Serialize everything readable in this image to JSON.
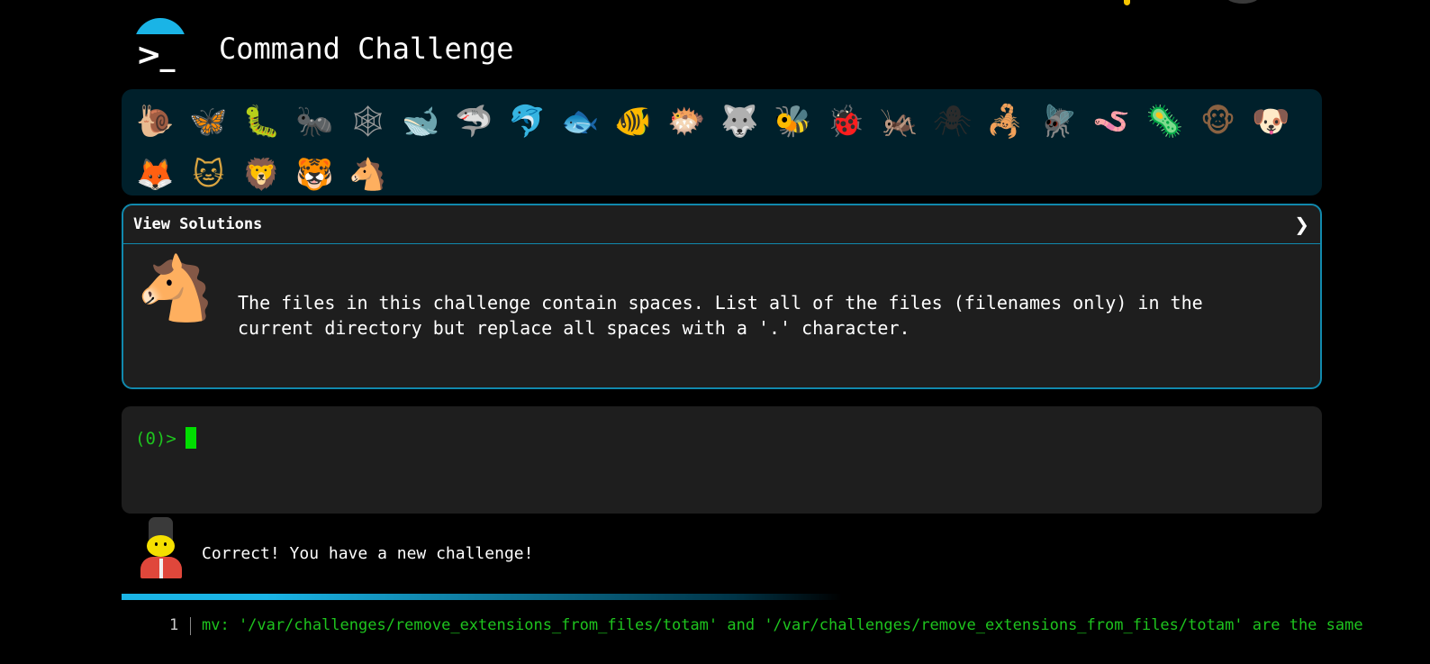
{
  "app": {
    "title": "Command Challenge",
    "logo_icon": "terminal-prompt-icon",
    "accent": "#1ab4e6"
  },
  "animals": [
    {
      "name": "snail",
      "glyph": "🐌",
      "color": "#b07a3c"
    },
    {
      "name": "butterfly",
      "glyph": "🦋",
      "color": "#e08a2c"
    },
    {
      "name": "bug",
      "glyph": "🐛",
      "color": "#7cc242"
    },
    {
      "name": "ant",
      "glyph": "🐜",
      "color": "#3a3a3a"
    },
    {
      "name": "spider-web",
      "glyph": "🕸",
      "color": "#9a9a9a"
    },
    {
      "name": "whale",
      "glyph": "🐋",
      "color": "#3fa3d8"
    },
    {
      "name": "shark",
      "glyph": "🦈",
      "color": "#3fa3d8"
    },
    {
      "name": "dolphin",
      "glyph": "🐬",
      "color": "#9aa6ad"
    },
    {
      "name": "fish",
      "glyph": "🐟",
      "color": "#53b7e8"
    },
    {
      "name": "tropical-fish",
      "glyph": "🐠",
      "color": "#f2c21b"
    },
    {
      "name": "blowfish",
      "glyph": "🐡",
      "color": "#a0713f"
    },
    {
      "name": "wolf",
      "glyph": "🐺",
      "color": "#8d9396"
    },
    {
      "name": "bee",
      "glyph": "🐝",
      "color": "#f5d33a"
    },
    {
      "name": "lady-beetle",
      "glyph": "🐞",
      "color": "#d22f2f"
    },
    {
      "name": "cricket",
      "glyph": "🦗",
      "color": "#6aa84f"
    },
    {
      "name": "spider",
      "glyph": "🕷",
      "color": "#2b2b2b"
    },
    {
      "name": "scorpion",
      "glyph": "🦂",
      "color": "#c0392b"
    },
    {
      "name": "fly",
      "glyph": "🪰",
      "color": "#9aa0a6"
    },
    {
      "name": "worm",
      "glyph": "🪱",
      "color": "#d97fa0"
    },
    {
      "name": "microbe",
      "glyph": "🦠",
      "color": "#3fa3d8"
    },
    {
      "name": "monkey",
      "glyph": "🐵",
      "color": "#8a6242"
    },
    {
      "name": "dog",
      "glyph": "🐶",
      "color": "#d49b4a"
    },
    {
      "name": "fox",
      "glyph": "🦊",
      "color": "#e2632b"
    },
    {
      "name": "cat",
      "glyph": "🐱",
      "color": "#d9a441"
    },
    {
      "name": "lion",
      "glyph": "🦁",
      "color": "#d9a441"
    },
    {
      "name": "tiger",
      "glyph": "🐯",
      "color": "#e8a53a"
    },
    {
      "name": "horse",
      "glyph": "🐴",
      "color": "#8b5a2b"
    }
  ],
  "solutions": {
    "header": "View Solutions",
    "toggle_icon": "chevron-right-icon",
    "animal_icon": "horse-icon",
    "animal_glyph": "🐴",
    "challenge_text": "The files in this challenge contain spaces. List all of the files (filenames only) in the current directory but replace all spaces with a '.' character."
  },
  "terminal": {
    "prompt": "(0)>",
    "input_value": ""
  },
  "feedback": {
    "icon": "guard-icon",
    "message": "Correct! You have a new challenge!"
  },
  "output": {
    "line_number": "1",
    "text": "mv: '/var/challenges/remove_extensions_from_files/totam' and '/var/challenges/remove_extensions_from_files/totam' are the same"
  }
}
